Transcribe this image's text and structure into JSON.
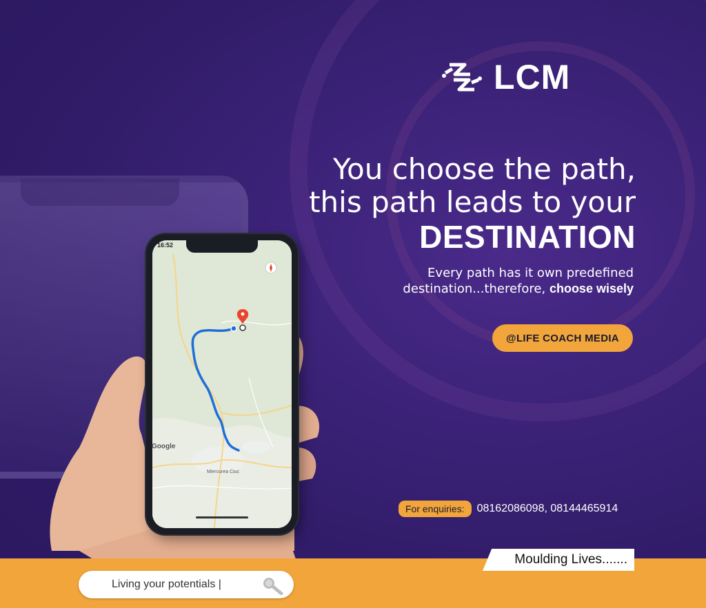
{
  "brand": {
    "name": "LCM"
  },
  "headline": {
    "line1": "You choose the path,",
    "line2": "this path leads to your",
    "line3": "DESTINATION"
  },
  "subtext": {
    "line1": "Every path has it own predefined",
    "line2_prefix": "destination...therefore, ",
    "line2_bold": "choose wisely"
  },
  "handle": "@LIFE COACH MEDIA",
  "enquiries": {
    "label": "For enquiries:",
    "numbers": "08162086098, 08144465914"
  },
  "tagline": "Moulding Lives.......",
  "search": {
    "text": "Living your potentials  |"
  },
  "phone": {
    "time": "16:52",
    "map_brand": "Google",
    "map_labels": {
      "town": "Miercurea Ciuc"
    }
  },
  "colors": {
    "accent": "#f1a53b",
    "background": "#2f1b66",
    "route": "#1e6fd9",
    "pin": "#e8452c"
  }
}
